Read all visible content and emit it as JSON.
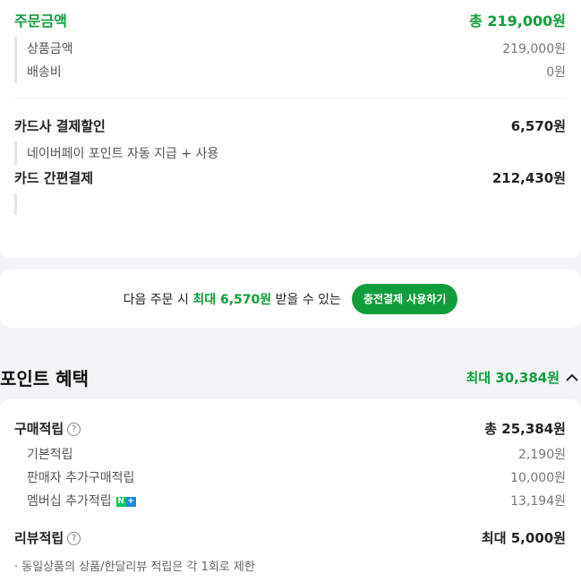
{
  "order": {
    "title": "주문금액",
    "total": "총 219,000원",
    "items": [
      {
        "label": "상품금액",
        "value": "219,000원"
      },
      {
        "label": "배송비",
        "value": "0원"
      }
    ],
    "card_discount_label": "카드사 결제할인",
    "card_discount_value": "6,570원",
    "card_discount_note": "네이버페이 포인트 자동 지급 + 사용",
    "easy_pay_label": "카드 간편결제",
    "easy_pay_value": "212,430원"
  },
  "promo": {
    "text_prefix": "다음 주문 시 ",
    "text_highlight": "최대 6,570원",
    "text_suffix": " 받을 수 있는",
    "button": "충전결제 사용하기"
  },
  "points": {
    "title": "포인트 혜택",
    "max": "최대 30,384원",
    "purchase_label": "구매적립",
    "purchase_total": "총 25,384원",
    "purchase_items": [
      {
        "label": "기본적립",
        "value": "2,190원"
      },
      {
        "label": "판매자 추가구매적립",
        "value": "10,000원"
      },
      {
        "label": "멤버십 추가적립",
        "value": "13,194원"
      }
    ],
    "review_label": "리뷰적립",
    "review_value": "최대 5,000원",
    "review_note": "· 동일상품의 상품/한달리뷰 적립은 각 1회로 제한",
    "help_glyph": "?",
    "badge_n": "N",
    "badge_plus": "+"
  },
  "colors": {
    "accent": "#109e3c",
    "background": "#f2f4f6",
    "badge_green": "#03c75a",
    "badge_blue": "#1e88e5"
  }
}
